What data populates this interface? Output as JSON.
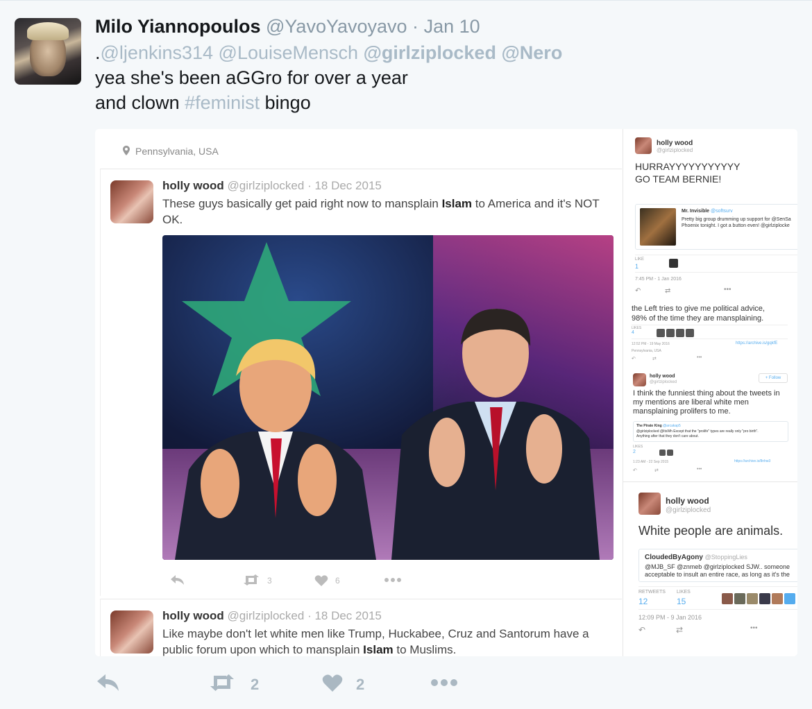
{
  "tweet": {
    "name": "Milo Yiannopoulos",
    "handle": "@YavoYavoyavo",
    "separator": "·",
    "date": "Jan 10",
    "line1": {
      "prefix": ".",
      "mention1": "@ljenkins314",
      "mention2": "@LouiseMensch",
      "mention3": "@girlziplocked",
      "mention4": "@Nero"
    },
    "line2": "yea she's been aGGro for over a year",
    "line3": {
      "before": "and clown ",
      "hashtag": "#feminist",
      "after": " bingo"
    },
    "actions": {
      "retweet_count": "2",
      "like_count": "2"
    }
  },
  "media": {
    "location": "Pennsylvania, USA",
    "post1": {
      "name": "holly wood",
      "handle": "@girlziplocked",
      "date": "· 18 Dec 2015",
      "text_a": "These guys basically get paid right now to mansplain ",
      "text_bold": "Islam",
      "text_b": " to America and it's NOT OK.",
      "retweets": "3",
      "likes": "6"
    },
    "post2": {
      "name": "holly wood",
      "handle": "@girlziplocked",
      "date": "· 18 Dec 2015",
      "text_a": "Like maybe don't let white men like Trump, Huckabee, Cruz and Santorum have a public forum upon which to mansplain ",
      "text_bold": "Islam",
      "text_b": " to Muslims."
    },
    "right": {
      "s1": {
        "name": "holly wood",
        "handle": "@girlziplocked",
        "text1": "HURRAYYYYYYYYYYY",
        "text2": "GO TEAM BERNIE!",
        "quote_name": "Mr. Invisible",
        "quote_handle": "@softsurv",
        "quote_text1": "Pretty big group drumming up support for @SenSa",
        "quote_text2": "Phoenix tonight. I got a button even! @girlziplocke",
        "like_label": "LIKE",
        "like_count": "1",
        "time": "7:45 PM - 1 Jan 2016"
      },
      "s2": {
        "text1": "the Left tries to give me political advice,",
        "text2": "98% of the time they are mansplaining.",
        "likes_label": "LIKES",
        "likes_count": "4",
        "time": "12:52 PM - 19 May 2016",
        "link": "https://archive.is/gqkfE",
        "location": "Pennsylvania, USA"
      },
      "s3": {
        "name": "holly wood",
        "handle": "@girlziplocked",
        "follow": "Follow",
        "text1": "I think the funniest thing about the tweets in",
        "text2": "my mentions are liberal white men",
        "text3": "mansplaining prolifers to me.",
        "quote_name": "The Pirate King",
        "quote_handle": "@arcakap5",
        "quote_text1": "@girlziplocked @ItsWh Except that the \"prolife\" types are really only \"pro birth\".",
        "quote_text2": "Anything after that they don't care about.",
        "likes_label": "LIKES",
        "likes_count": "2",
        "time": "1:23 AM - 22 Sep 2015",
        "link": "https://archive.is/8nhw3"
      },
      "s4": {
        "name": "holly wood",
        "handle": "@girlziplocked",
        "text": "White people are animals.",
        "quote_name": "CloudedByAgony",
        "quote_handle": "@StoppingLies",
        "quote_text1": "@MJB_SF @znmeb @girlziplocked SJW.. someone",
        "quote_text2": "acceptable to insult an entire race, as long as it's the",
        "retweets_label": "RETWEETS",
        "retweets_count": "12",
        "likes_label": "LIKES",
        "likes_count": "15",
        "time": "12:09 PM - 9 Jan 2016"
      }
    }
  },
  "colors": {
    "muted": "#aab8c2",
    "link": "#55acee",
    "bg": "#f5f8fa"
  }
}
